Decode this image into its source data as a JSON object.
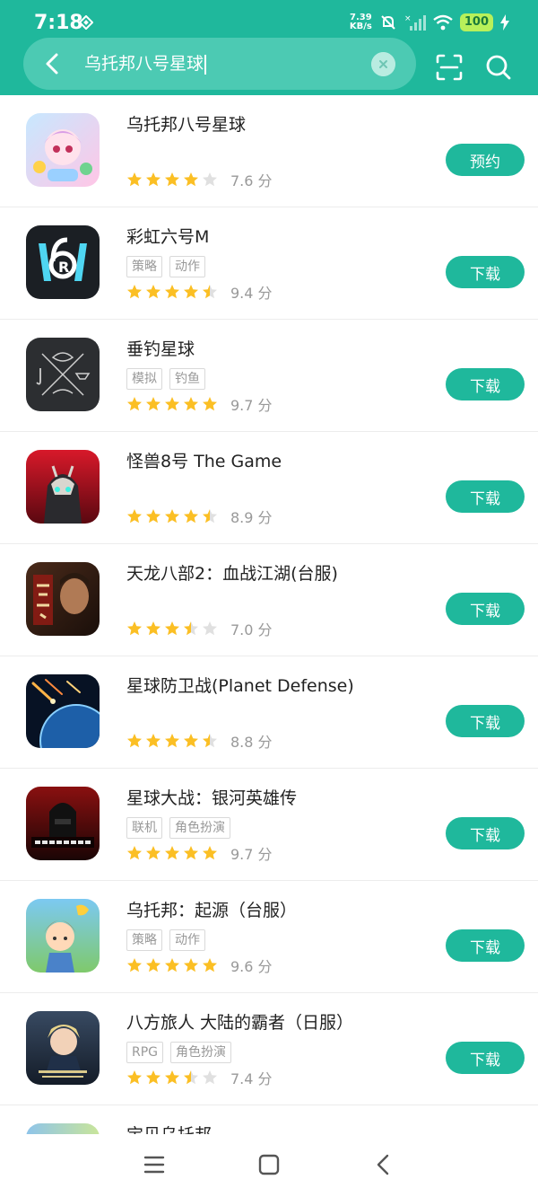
{
  "status_bar": {
    "time": "7:18",
    "net_speed_value": "7.39",
    "net_speed_unit": "KB/s",
    "battery": "100"
  },
  "search": {
    "query": "乌托邦八号星球"
  },
  "colors": {
    "accent": "#1fb89c",
    "star_filled": "#fbbf24",
    "star_empty": "#e0e0e0"
  },
  "results": [
    {
      "title": "乌托邦八号星球",
      "tags": [],
      "stars": 4,
      "score": "7.6 分",
      "action": "预约"
    },
    {
      "title": "彩虹六号M",
      "tags": [
        "策略",
        "动作"
      ],
      "stars": 4.5,
      "score": "9.4 分",
      "action": "下载"
    },
    {
      "title": "垂钓星球",
      "tags": [
        "模拟",
        "钓鱼"
      ],
      "stars": 5,
      "score": "9.7 分",
      "action": "下载"
    },
    {
      "title": "怪兽8号 The Game",
      "tags": [],
      "stars": 4.5,
      "score": "8.9 分",
      "action": "下载"
    },
    {
      "title": "天龙八部2：血战江湖(台服)",
      "tags": [],
      "stars": 3.5,
      "score": "7.0 分",
      "action": "下载"
    },
    {
      "title": "星球防卫战(Planet Defense)",
      "tags": [],
      "stars": 4.5,
      "score": "8.8 分",
      "action": "下载"
    },
    {
      "title": "星球大战：银河英雄传",
      "tags": [
        "联机",
        "角色扮演"
      ],
      "stars": 5,
      "score": "9.7 分",
      "action": "下载"
    },
    {
      "title": "乌托邦：起源（台服）",
      "tags": [
        "策略",
        "动作"
      ],
      "stars": 5,
      "score": "9.6 分",
      "action": "下载"
    },
    {
      "title": "八方旅人 大陆的霸者（日服）",
      "tags": [
        "RPG",
        "角色扮演"
      ],
      "stars": 3.5,
      "score": "7.4 分",
      "action": "下载"
    },
    {
      "title": "宝贝乌托邦",
      "tags": [],
      "stars": 0,
      "score": "",
      "action": ""
    }
  ],
  "icon_art": {
    "2": "R"
  }
}
